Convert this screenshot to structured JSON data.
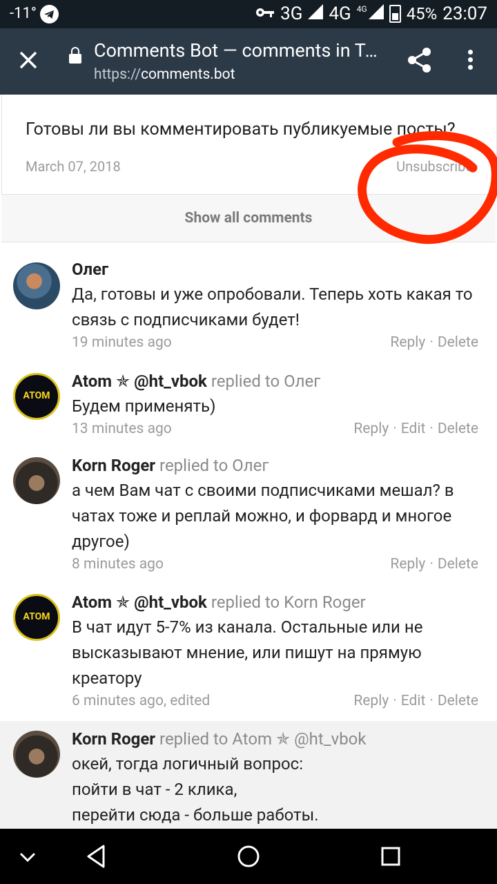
{
  "status_bar": {
    "temperature": "-11°",
    "network_1": "3G",
    "network_2": "4G",
    "network_2_small": "4G",
    "battery": "45%",
    "time": "23:07"
  },
  "toolbar": {
    "title": "Comments Bot — comments in Telegram",
    "url_prefix": "https://",
    "url_host": "comments.bot"
  },
  "post": {
    "text": "Готовы ли вы комментировать публикуемые посты?",
    "date": "March 07, 2018",
    "unsubscribe_label": "Unsubscribe"
  },
  "show_all_label": "Show all comments",
  "comments": [
    {
      "author": "Олег",
      "replied": "",
      "text": "Да, готовы и уже опробовали. Теперь хоть какая то связь с подписчиками будет!",
      "time": "19 minutes ago",
      "reply": "Reply",
      "edit": "",
      "delete": "Delete"
    },
    {
      "author": "Atom ✯ @ht_vbok",
      "replied": "replied to Олег",
      "text": "Будем применять)",
      "time": "13 minutes ago",
      "reply": "Reply",
      "edit": "Edit",
      "delete": "Delete"
    },
    {
      "author": "Korn Roger",
      "replied": "replied to Олег",
      "text": "а чем Вам чат с своими подписчиками мешал? в чатах тоже и реплай можно, и форвард и многое другое)",
      "time": "8 minutes ago",
      "reply": "Reply",
      "edit": "",
      "delete": "Delete"
    },
    {
      "author": "Atom ✯ @ht_vbok",
      "replied": "replied to Korn Roger",
      "text": "В чат идут 5-7% из канала. Остальные или не высказывают мнение, или пишут на прямую креатору",
      "time": "6 minutes ago, edited",
      "reply": "Reply",
      "edit": "Edit",
      "delete": "Delete"
    },
    {
      "author": "Korn Roger",
      "replied": "replied to Atom ✯ @ht_vbok",
      "text_lines": [
        "окей, тогда логичный вопрос:",
        "пойти в чат - 2 клика,",
        "перейти сюда - больше работы."
      ]
    }
  ],
  "avatars": {
    "atom_label": "ATOM"
  },
  "colors": {
    "annotation": "#ff2a00",
    "toolbar": "#2c3a48",
    "status_bar": "#151d24"
  }
}
